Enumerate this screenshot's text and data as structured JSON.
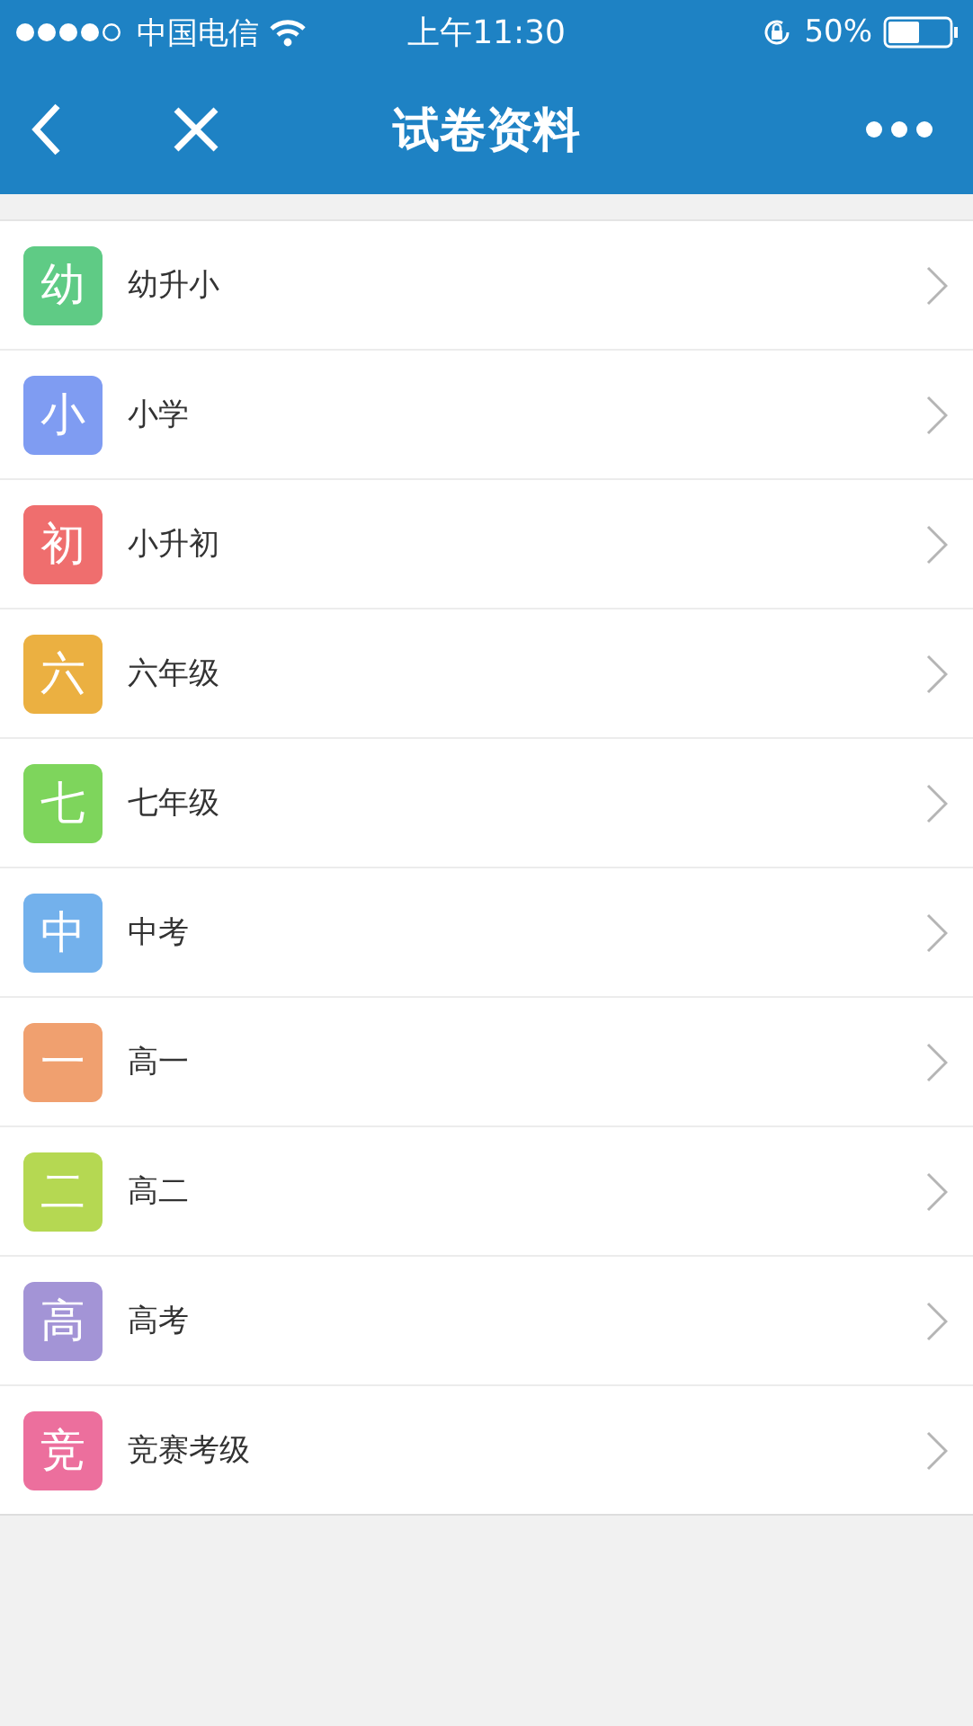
{
  "status_bar": {
    "carrier": "中国电信",
    "time": "上午11:30",
    "battery": "50%"
  },
  "nav_bar": {
    "title": "试卷资料"
  },
  "items": [
    {
      "badge": "幼",
      "label": "幼升小",
      "color": "#5fcb85"
    },
    {
      "badge": "小",
      "label": "小学",
      "color": "#7f9cf2"
    },
    {
      "badge": "初",
      "label": "小升初",
      "color": "#ef6e6e"
    },
    {
      "badge": "六",
      "label": "六年级",
      "color": "#ebb041"
    },
    {
      "badge": "七",
      "label": "七年级",
      "color": "#7ed55c"
    },
    {
      "badge": "中",
      "label": "中考",
      "color": "#73b1ec"
    },
    {
      "badge": "一",
      "label": "高一",
      "color": "#f0a06f"
    },
    {
      "badge": "二",
      "label": "高二",
      "color": "#b5d852"
    },
    {
      "badge": "高",
      "label": "高考",
      "color": "#a394d6"
    },
    {
      "badge": "竞",
      "label": "竞赛考级",
      "color": "#ec6f9d"
    }
  ]
}
